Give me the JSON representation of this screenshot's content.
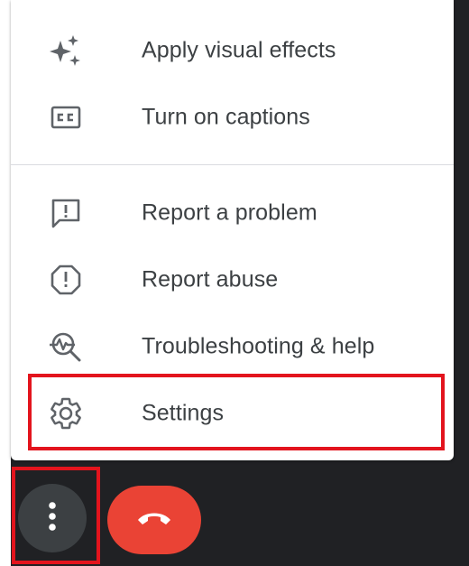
{
  "menu": {
    "items": [
      {
        "label": "Apply visual effects",
        "icon": "sparkle-icon"
      },
      {
        "label": "Turn on captions",
        "icon": "closed-captions-icon"
      },
      {
        "label": "Report a problem",
        "icon": "feedback-icon"
      },
      {
        "label": "Report abuse",
        "icon": "report-icon"
      },
      {
        "label": "Troubleshooting & help",
        "icon": "troubleshoot-icon"
      },
      {
        "label": "Settings",
        "icon": "gear-icon"
      }
    ]
  },
  "controls": {
    "more_options_icon": "more-vert-icon",
    "end_call_icon": "call-end-icon"
  },
  "colors": {
    "background": "#202124",
    "menu_background": "#ffffff",
    "text": "#3c4043",
    "icon": "#5f6368",
    "highlight": "#e3141d",
    "end_call": "#ea4335",
    "more_button": "#3c4043"
  }
}
